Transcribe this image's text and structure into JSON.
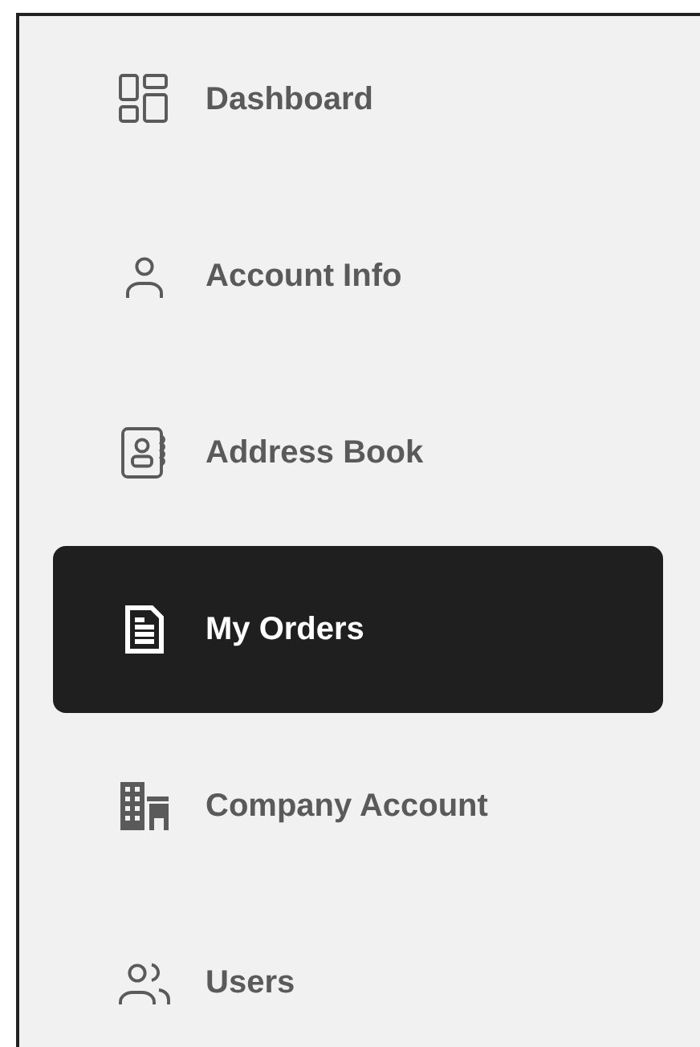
{
  "sidebar": {
    "items": [
      {
        "label": "Dashboard",
        "selected": false
      },
      {
        "label": "Account Info",
        "selected": false
      },
      {
        "label": "Address Book",
        "selected": false
      },
      {
        "label": "My Orders",
        "selected": true
      },
      {
        "label": "Company Account",
        "selected": false
      },
      {
        "label": "Users",
        "selected": false
      }
    ]
  }
}
